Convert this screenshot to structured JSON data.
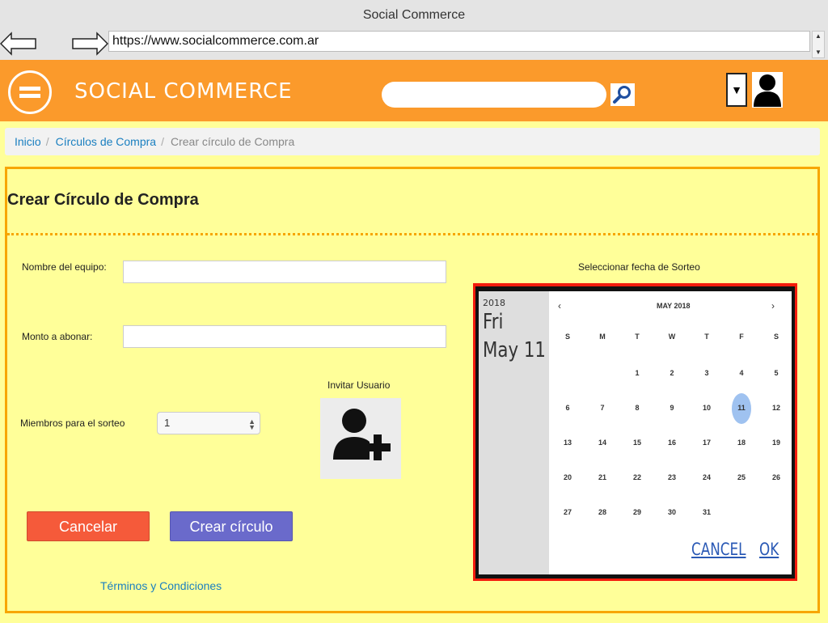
{
  "browser": {
    "title": "Social Commerce",
    "url": "https://www.socialcommerce.com.ar"
  },
  "header": {
    "brand": "SOCIAL COMMERCE",
    "search_placeholder": "",
    "dropdown_symbol": "▼",
    "colors": {
      "header_bg": "#fb9a2b",
      "page_bg": "#ffff99"
    }
  },
  "breadcrumb": {
    "items": [
      "Inicio",
      "Círculos de Compra"
    ],
    "current": "Crear círculo de Compra",
    "separator": "/"
  },
  "form": {
    "title": "Crear Círculo de Compra",
    "team_name_label": "Nombre del equipo:",
    "team_name_value": "",
    "amount_label": "Monto a abonar:",
    "amount_value": "",
    "members_label": "Miembros para el sorteo",
    "members_value": "1",
    "invite_label": "Invitar Usuario",
    "cancel_label": "Cancelar",
    "create_label": "Crear círculo",
    "terms_label": "Términos y Condiciones"
  },
  "picker": {
    "label": "Seleccionar fecha de Sorteo",
    "year": "2018",
    "weekday": "Fri",
    "date": "May 11",
    "month_title": "MAY 2018",
    "prev": "‹",
    "next": "›",
    "weekdays": [
      "S",
      "M",
      "T",
      "W",
      "T",
      "F",
      "S"
    ],
    "weeks": [
      [
        "",
        "",
        "1",
        "2",
        "3",
        "4",
        "5"
      ],
      [
        "6",
        "7",
        "8",
        "9",
        "10",
        "11",
        "12"
      ],
      [
        "13",
        "14",
        "15",
        "16",
        "17",
        "18",
        "19"
      ],
      [
        "20",
        "21",
        "22",
        "23",
        "24",
        "25",
        "26"
      ],
      [
        "27",
        "28",
        "29",
        "30",
        "31",
        "",
        ""
      ]
    ],
    "selected_day": "11",
    "cancel_label": "CANCEL",
    "ok_label": "OK"
  }
}
